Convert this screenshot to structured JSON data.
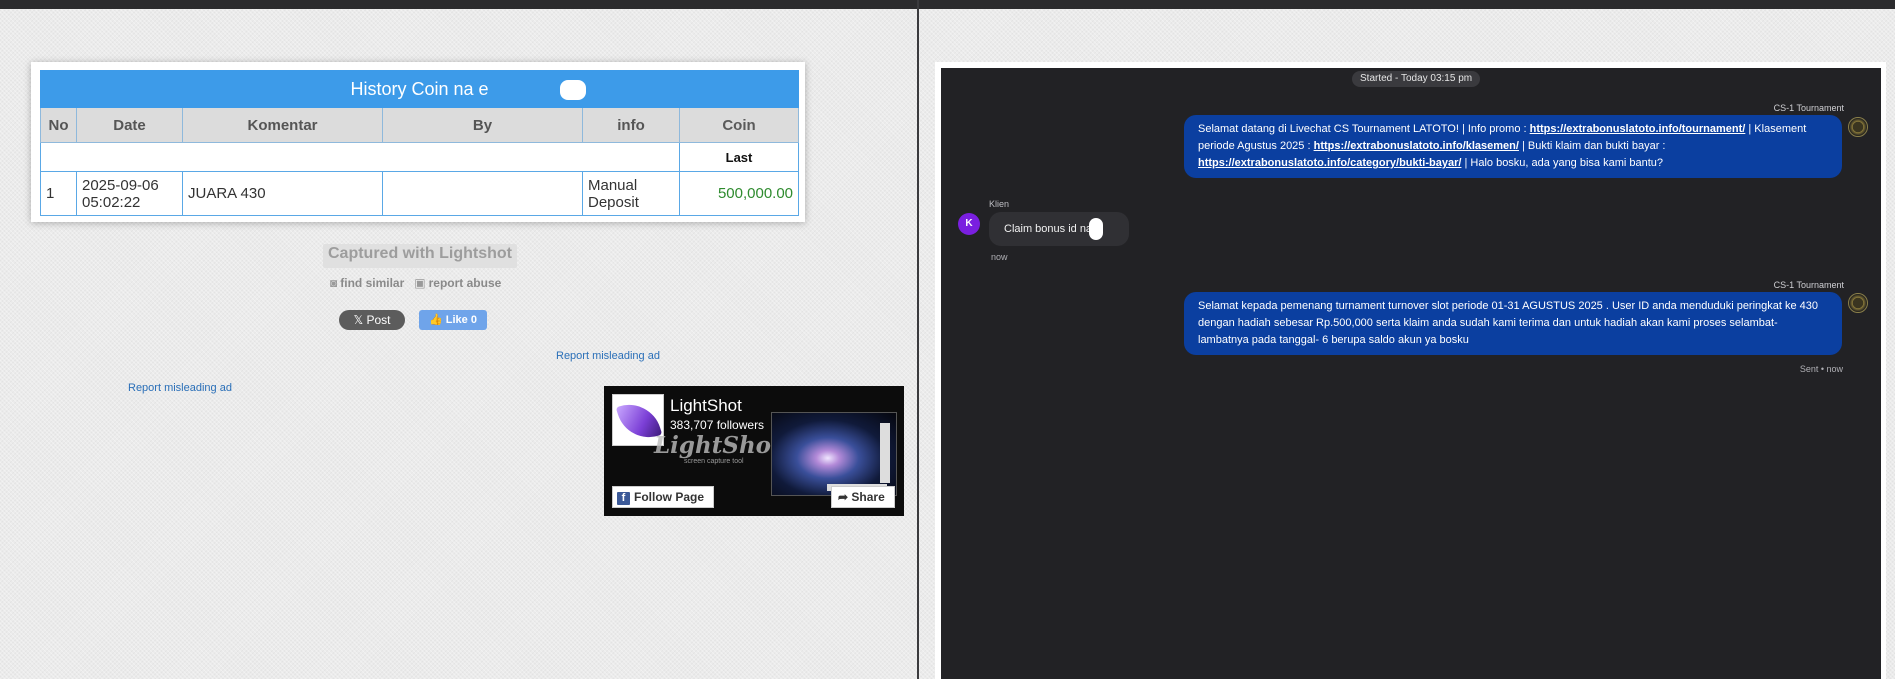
{
  "history": {
    "title": "History Coin na e",
    "columns": [
      "No",
      "Date",
      "Komentar",
      "By",
      "info",
      "Coin"
    ],
    "subheader_last": "Last",
    "row": {
      "no": "1",
      "date_line1": "2025-09-06",
      "date_line2": "05:02:22",
      "komentar": "JUARA 430",
      "by": "",
      "info_line1": "Manual",
      "info_line2": "Deposit",
      "coin": "500,000.00"
    }
  },
  "lightshot": {
    "captured": "Captured with Lightshot",
    "find_similar": "find similar",
    "report_abuse": "report abuse",
    "x_post": "Post",
    "fb_like": "Like 0",
    "report_ad_1": "Report misleading ad",
    "report_ad_2": "Report misleading ad"
  },
  "fb_widget": {
    "page_name": "LightShot",
    "followers": "383,707 followers",
    "brand": "LightShot",
    "tagline": "screen capture tool",
    "follow_label": "Follow Page",
    "share_label": "Share"
  },
  "chat": {
    "started": "Started - Today 03:15 pm",
    "agent_name_1": "CS-1 Tournament",
    "msg1_a": "Selamat datang di Livechat CS Tournament LATOTO! | Info promo : ",
    "msg1_link1": "https://extrabonuslatoto.info/tournament/",
    "msg1_b": " | Klasement periode Agustus 2025 : ",
    "msg1_link2": "https://extrabonuslatoto.info/klasemen/",
    "msg1_c": " | Bukti klaim dan bukti bayar : ",
    "msg1_link3": "https://extrabonuslatoto.info/category/bukti-bayar/",
    "msg1_d": " | Halo bosku, ada yang bisa kami bantu?",
    "client_name": "Klien",
    "client_initial": "K",
    "client_msg": "Claim bonus id na e",
    "client_time": "now",
    "agent_name_2": "CS-1 Tournament",
    "msg2": "Selamat kepada pemenang turnament turnover slot periode 01-31 AGUSTUS 2025 . User ID anda menduduki peringkat ke 430 dengan hadiah sebesar Rp.500,000 serta klaim anda sudah kami terima dan untuk hadiah akan kami proses selambat-lambatnya pada tanggal- 6 berupa saldo akun ya bosku",
    "sent_status": "Sent • now"
  }
}
